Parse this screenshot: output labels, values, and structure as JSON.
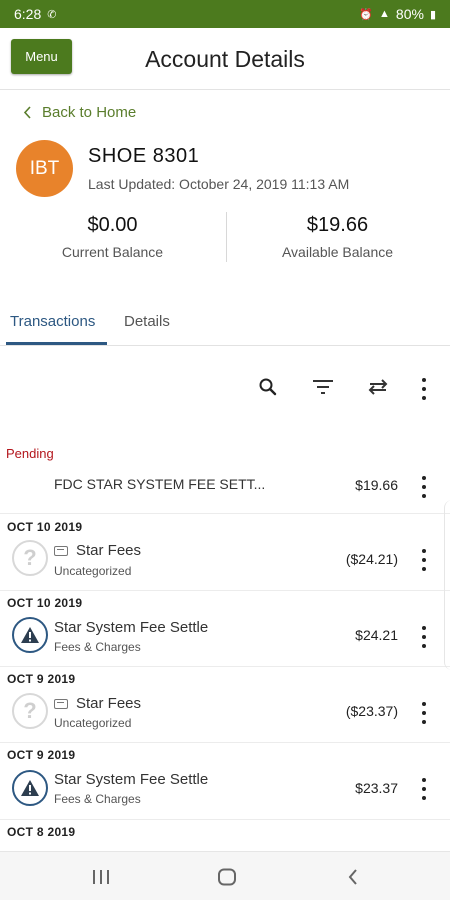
{
  "status_bar": {
    "time": "6:28",
    "battery": "80%"
  },
  "header": {
    "menu_label": "Menu",
    "title": "Account Details"
  },
  "back_label": "Back to Home",
  "account": {
    "avatar_initials": "IBT",
    "avatar_color": "#e8832b",
    "name": "SHOE 8301",
    "last_updated": "Last Updated: October 24, 2019 11:13 AM",
    "current_balance": "$0.00",
    "current_balance_label": "Current Balance",
    "available_balance": "$19.66",
    "available_balance_label": "Available Balance"
  },
  "tabs": [
    {
      "label": "Transactions",
      "active": true
    },
    {
      "label": "Details",
      "active": false
    }
  ],
  "toolbar": {
    "icons": [
      "search-icon",
      "filter-icon",
      "sort-icon",
      "more-options-icon"
    ]
  },
  "pending": {
    "label": "Pending",
    "items": [
      {
        "name": "FDC STAR SYSTEM FEE SETT...",
        "amount": "$19.66"
      }
    ]
  },
  "transactions": [
    {
      "date": "OCT 10 2019",
      "name": "Star Fees",
      "category": "Uncategorized",
      "amount": "($24.21)",
      "icon": "question-icon"
    },
    {
      "date": "OCT 10 2019",
      "name": "Star System Fee Settle",
      "category": "Fees & Charges",
      "amount": "$24.21",
      "icon": "warning-icon"
    },
    {
      "date": "OCT 9 2019",
      "name": "Star Fees",
      "category": "Uncategorized",
      "amount": "($23.37)",
      "icon": "question-icon"
    },
    {
      "date": "OCT 9 2019",
      "name": "Star System Fee Settle",
      "category": "Fees & Charges",
      "amount": "$23.37",
      "icon": "warning-icon"
    },
    {
      "date": "OCT 8 2019"
    }
  ],
  "colors": {
    "brand_green": "#4c7a1e",
    "accent_blue": "#2d5882",
    "pending_red": "#b3161d"
  }
}
